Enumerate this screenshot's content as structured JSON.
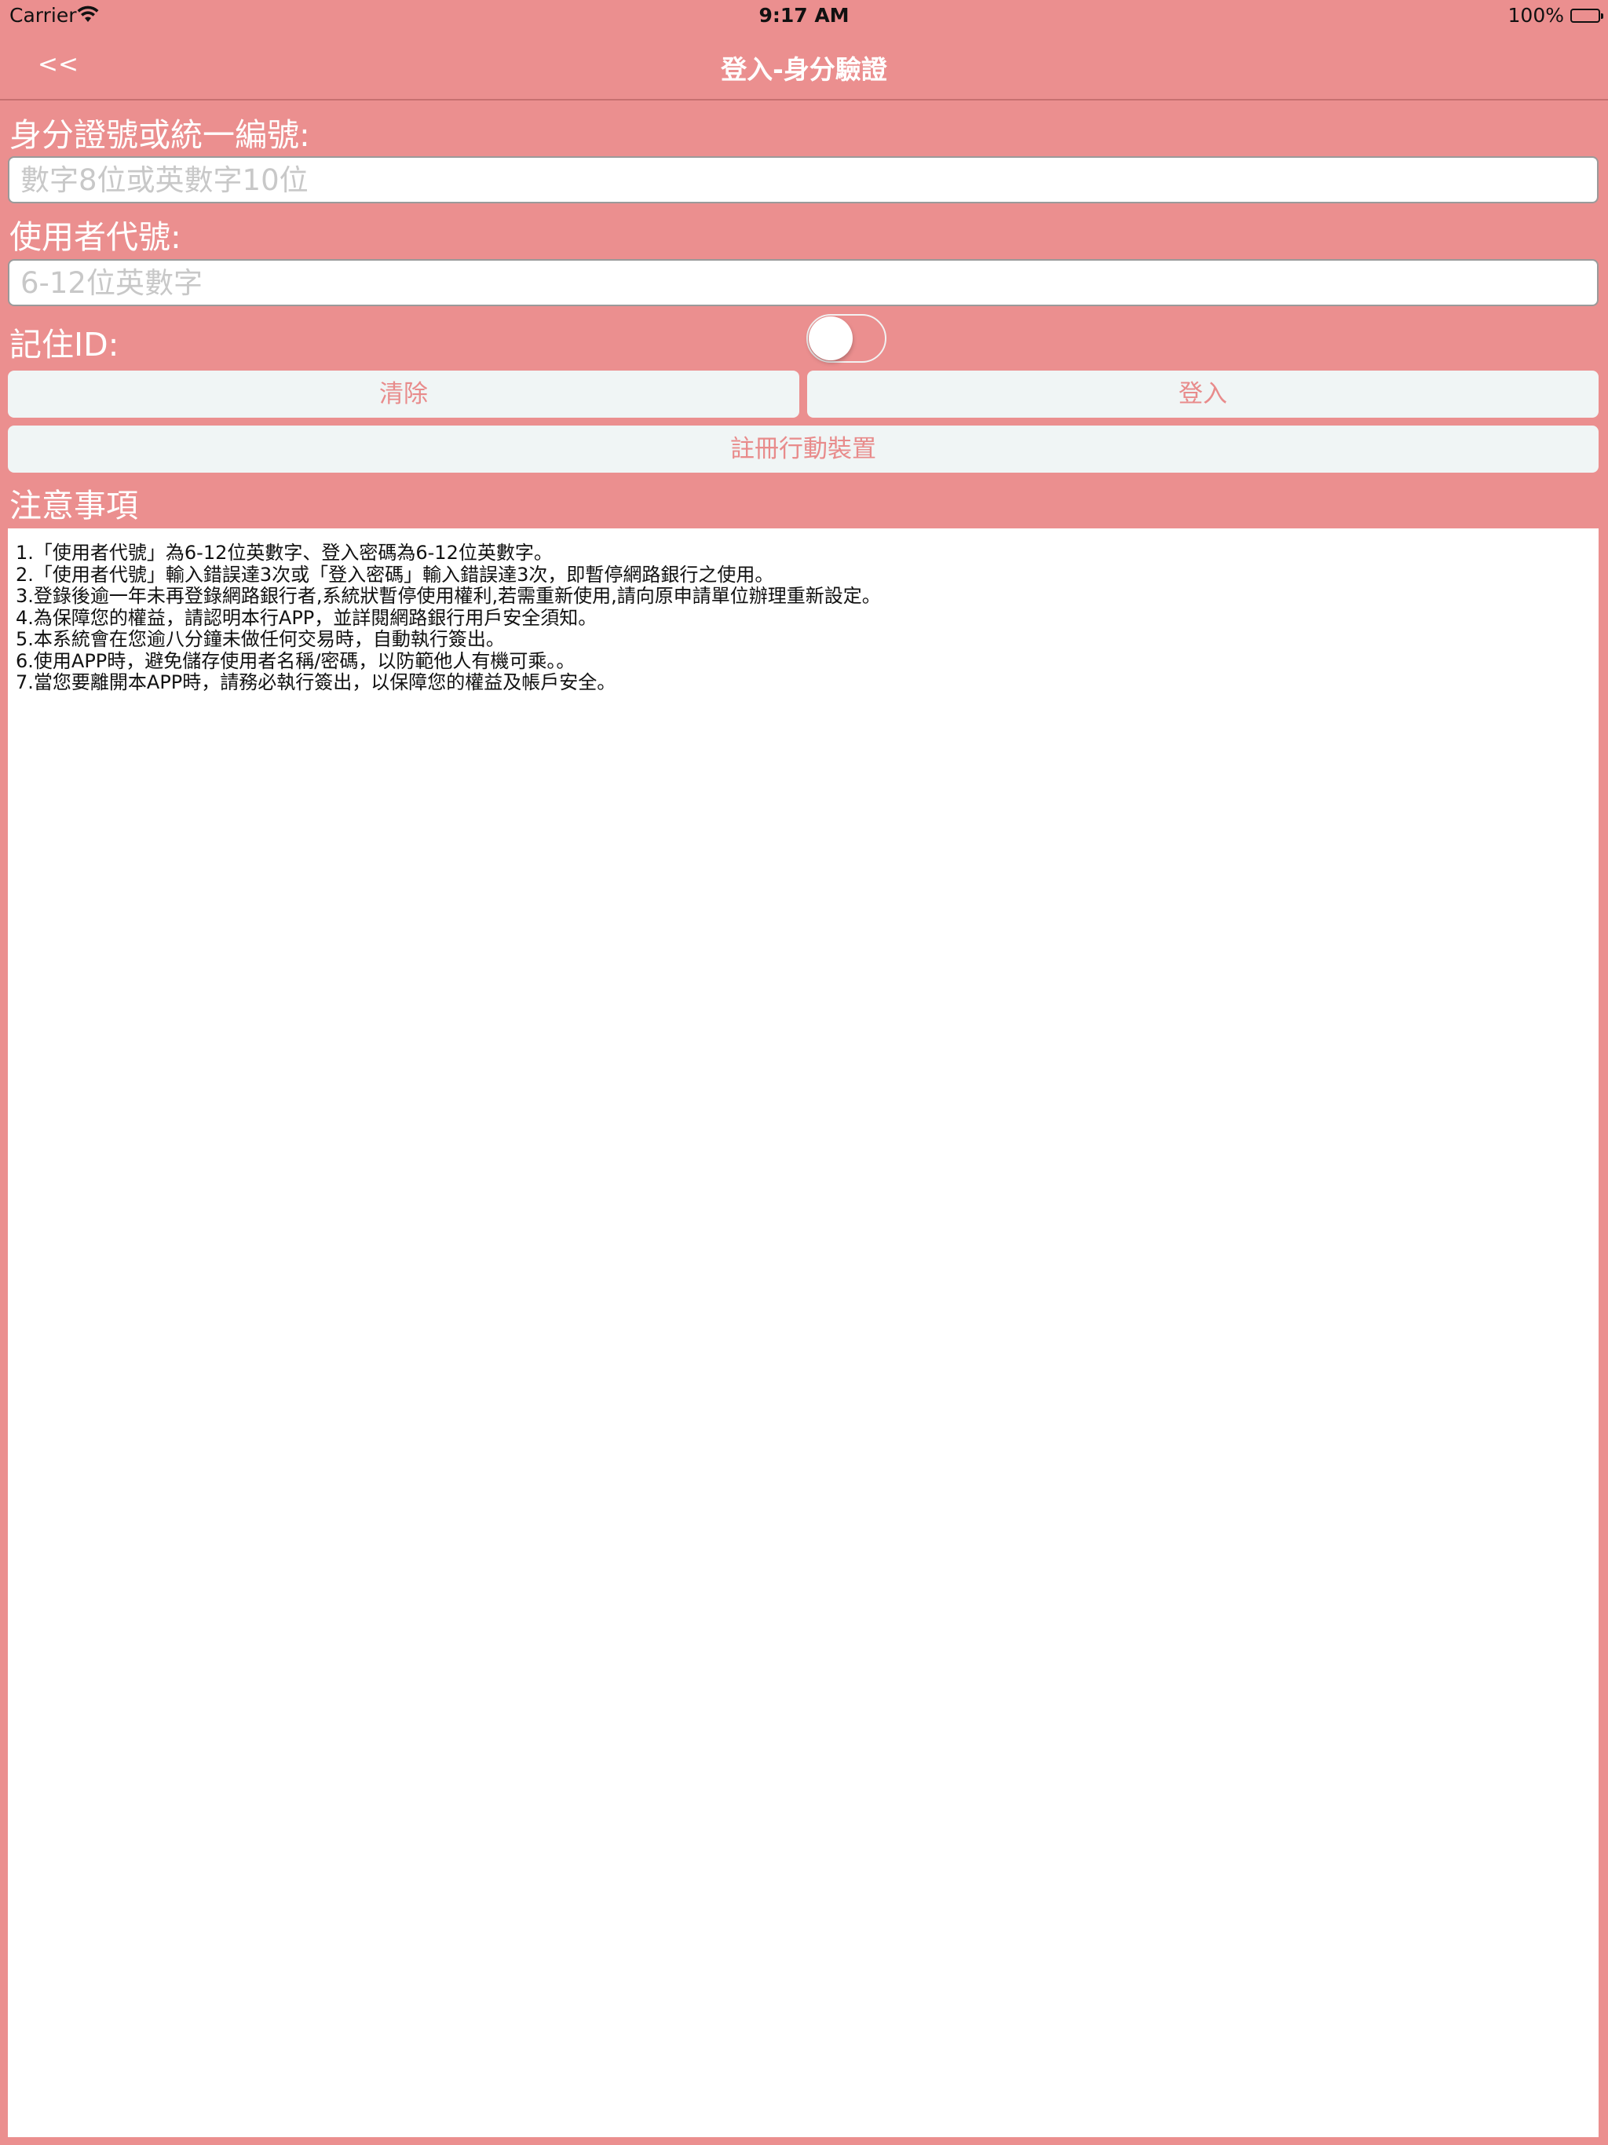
{
  "status_bar": {
    "carrier": "Carrier",
    "time": "9:17 AM",
    "battery": "100%"
  },
  "nav": {
    "back_label": "<<",
    "title": "登入-身分驗證"
  },
  "form": {
    "id_label": "身分證號或統一編號:",
    "id_placeholder": "數字8位或英數字10位",
    "user_label": "使用者代號:",
    "user_placeholder": "6-12位英數字",
    "remember_label": "記住ID:",
    "remember_on": false
  },
  "buttons": {
    "clear": "清除",
    "login": "登入",
    "register": "註冊行動裝置"
  },
  "notes": {
    "heading": "注意事項",
    "lines": [
      "1.「使用者代號」為6-12位英數字、登入密碼為6-12位英數字。",
      "2.「使用者代號」輸入錯誤達3次或「登入密碼」輸入錯誤達3次，即暫停網路銀行之使用。",
      "3.登錄後逾一年未再登錄網路銀行者,系統狀暫停使用權利,若需重新使用,請向原申請單位辦理重新設定。",
      "4.為保障您的權益，請認明本行APP，並詳閱網路銀行用戶安全須知。",
      "5.本系統會在您逾八分鐘未做任何交易時，自動執行簽出。",
      "6.使用APP時，避免儲存使用者名稱/密碼，以防範他人有機可乘。。",
      "7.當您要離開本APP時，請務必執行簽出，以保障您的權益及帳戶安全。"
    ]
  },
  "colors": {
    "background": "#EB8F8F",
    "button_bg": "#F0F5F5",
    "button_text": "#E88B8B"
  },
  "icons": {
    "wifi": "wifi-icon",
    "battery": "battery-icon"
  }
}
